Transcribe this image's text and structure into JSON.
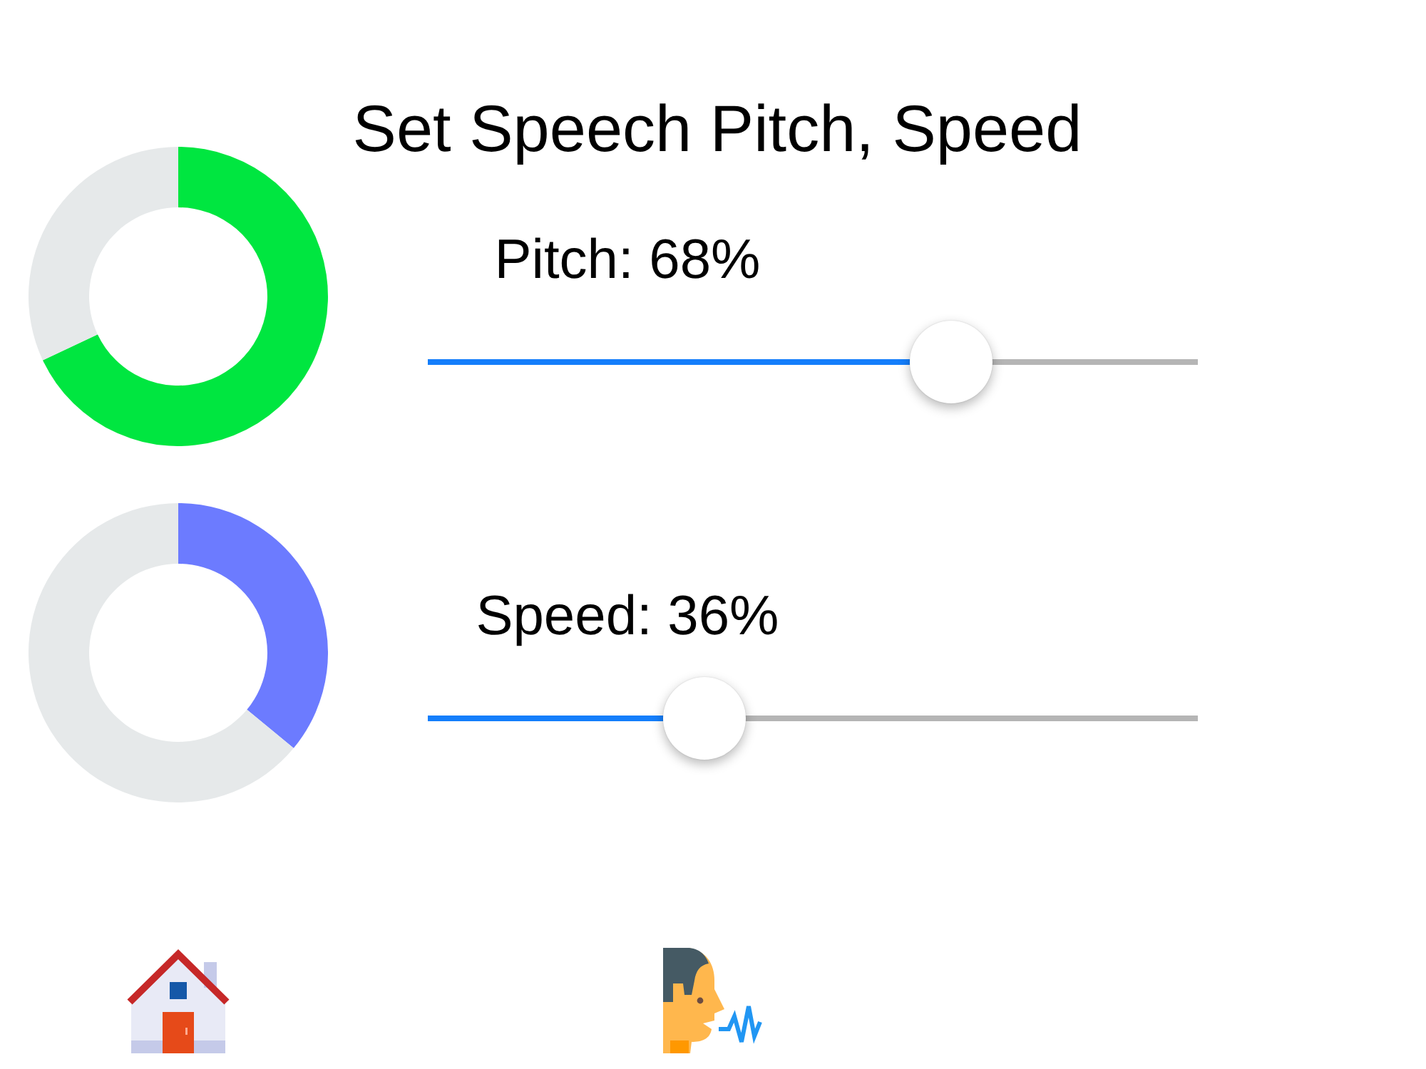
{
  "title": "Set Speech Pitch, Speed",
  "settings": [
    {
      "label": "Pitch: 68%",
      "gauge": {
        "color": "#00e640",
        "chart_data": {
          "type": "donut",
          "values": [
            68,
            32
          ]
        }
      },
      "slider": {
        "level": 0.68
      }
    },
    {
      "label": "Speed: 36%",
      "gauge": {
        "color": "#6c7bff",
        "chart_data": {
          "type": "donut",
          "values": [
            36,
            64
          ]
        }
      },
      "slider": {
        "level": 0.36
      }
    }
  ]
}
